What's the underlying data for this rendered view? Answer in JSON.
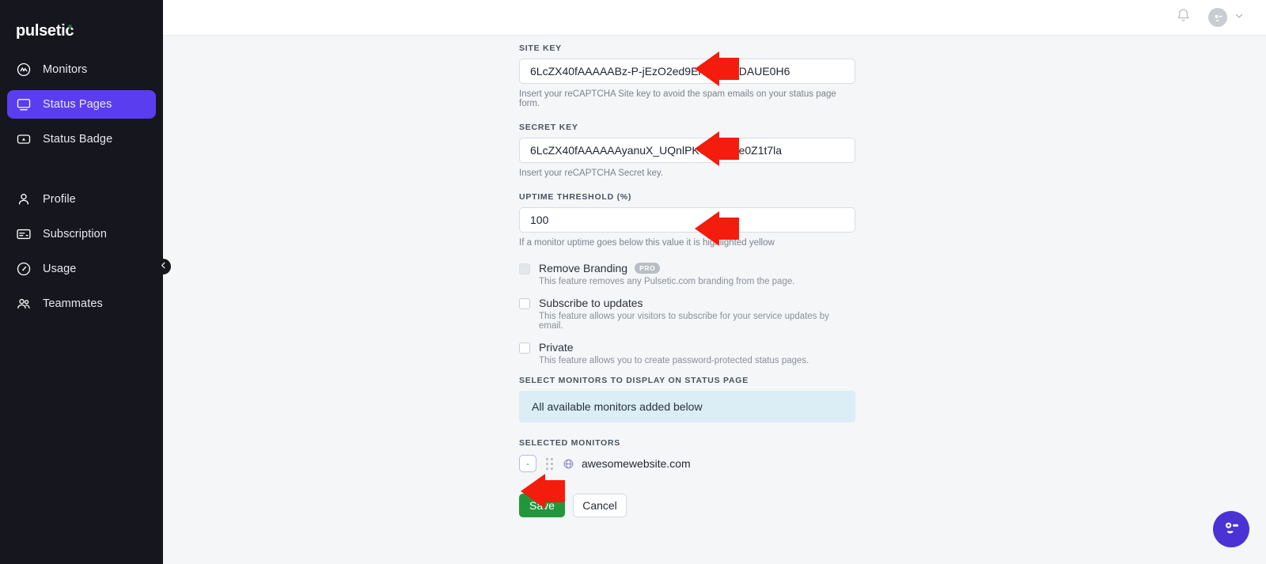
{
  "brand": {
    "name": "pulsetic"
  },
  "sidebar": {
    "primary": [
      {
        "label": "Monitors",
        "icon": "monitors-icon",
        "active": false
      },
      {
        "label": "Status Pages",
        "icon": "status-pages-icon",
        "active": true
      },
      {
        "label": "Status Badge",
        "icon": "status-badge-icon",
        "active": false
      }
    ],
    "secondary": [
      {
        "label": "Profile",
        "icon": "profile-icon"
      },
      {
        "label": "Subscription",
        "icon": "subscription-icon"
      },
      {
        "label": "Usage",
        "icon": "usage-icon"
      },
      {
        "label": "Teammates",
        "icon": "teammates-icon"
      }
    ],
    "collapse_icon": "chevron-left-icon",
    "active_color": "#5b3df0",
    "background": "#16161f"
  },
  "topbar": {
    "notifications_icon": "bell-icon",
    "avatar_icon": "user-avatar-icon",
    "account_menu_icon": "chevron-down-icon"
  },
  "form": {
    "site_key": {
      "label": "SITE KEY",
      "value": "6LcZX40fAAAAABz-P-jEzO2ed9ErSVCR0DAUE0H6",
      "helper": "Insert your reCAPTCHA Site key to avoid the spam emails on your status page form."
    },
    "secret_key": {
      "label": "SECRET KEY",
      "value": "6LcZX40fAAAAAAyanuX_UQnlPKO32gnbe0Z1t7la",
      "helper": "Insert your reCAPTCHA Secret key."
    },
    "uptime_threshold": {
      "label": "UPTIME THRESHOLD (%)",
      "value": "100",
      "helper": "If a monitor uptime goes below this value it is highlighted yellow"
    },
    "checkboxes": [
      {
        "label": "Remove Branding",
        "badge": "PRO",
        "description": "This feature removes any Pulsetic.com branding from the page.",
        "checked": false,
        "disabled": true
      },
      {
        "label": "Subscribe to updates",
        "badge": "",
        "description": "This feature allows your visitors to subscribe for your service updates by email.",
        "checked": false,
        "disabled": false
      },
      {
        "label": "Private",
        "badge": "",
        "description": "This feature allows you to create password-protected status pages.",
        "checked": false,
        "disabled": false
      }
    ],
    "select_monitors": {
      "label": "SELECT MONITORS TO DISPLAY ON STATUS PAGE",
      "info_text": "All available monitors added below",
      "info_bg": "#dceef5"
    },
    "selected_monitors": {
      "label": "SELECTED MONITORS",
      "items": [
        {
          "name": "awesomewebsite.com",
          "remove_label": "-",
          "drag_icon": "drag-handle-icon",
          "site_icon": "globe-icon"
        }
      ]
    },
    "actions": {
      "save_label": "Save",
      "cancel_label": "Cancel",
      "save_color": "#22963c"
    }
  },
  "annotations": {
    "color": "#f41c0c",
    "arrows": [
      {
        "target": "site-key-input"
      },
      {
        "target": "secret-key-input"
      },
      {
        "target": "uptime-threshold-input"
      },
      {
        "target": "selected-monitor-row"
      }
    ]
  },
  "chat_widget": {
    "icon": "chat-face-icon",
    "color": "#4b32d4"
  }
}
